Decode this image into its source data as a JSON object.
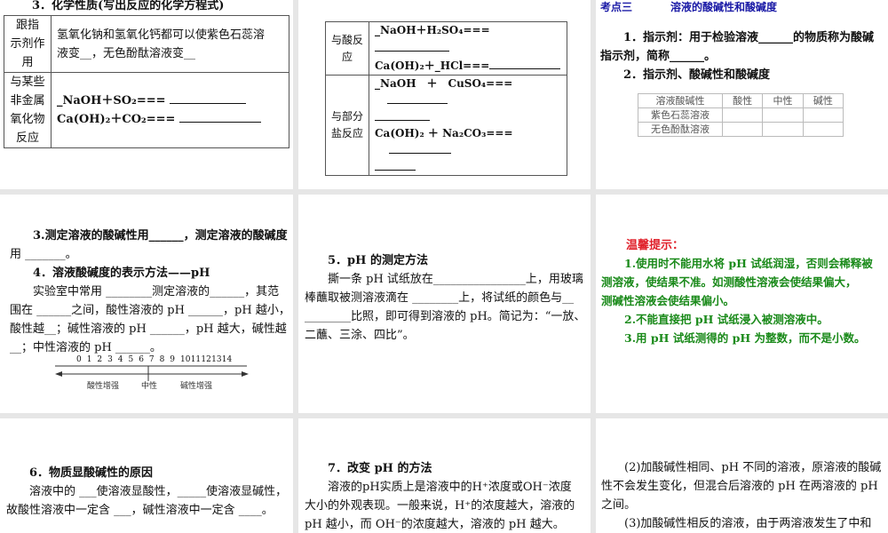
{
  "slides": {
    "s1": {
      "title": "3．化学性质(写出反应的化学方程式)",
      "rows": [
        {
          "head": [
            "跟指",
            "示剂作",
            "用"
          ],
          "lines": [
            "氢氧化钠和氢氧化钙都可以使紫色石蕊溶",
            "液变__，无色酚酞溶液变__"
          ]
        },
        {
          "head": [
            "与某些",
            "非金属",
            "氧化物",
            "反应"
          ],
          "lines": [
            "_NaOH＋SO₂===",
            "Ca(OH)₂＋CO₂==="
          ]
        }
      ]
    },
    "s2": {
      "rows": [
        {
          "head": [
            "与酸反",
            "应"
          ],
          "lines": [
            "_NaOH＋H₂SO₄===",
            "Ca(OH)₂＋_HCl==="
          ]
        },
        {
          "head": [
            "与部分",
            "盐反应"
          ],
          "lines": [
            "_NaOH　＋　CuSO₄===",
            "Ca(OH)₂ ＋ Na₂CO₃==="
          ]
        }
      ]
    },
    "s3": {
      "header_label": "考点三",
      "header_title": "溶液的酸碱性和酸碱度",
      "lines": [
        "1．指示剂：用于检验溶液______的物质称为酸碱",
        "指示剂，简称______。",
        "2．指示剂、酸碱性和酸碱度"
      ],
      "table": {
        "headers": [
          "溶液酸碱性",
          "酸性",
          "中性",
          "碱性"
        ],
        "rows": [
          "紫色石蕊溶液",
          "无色酚酞溶液"
        ]
      }
    },
    "s4": {
      "lines": [
        "3.测定溶液的酸碱性用______，测定溶液的酸碱度",
        "用 _______。",
        "4．溶液酸碱度的表示方法——pH",
        "实验室中常用 ________测定溶液的______，其范",
        "围在 ______之间，酸性溶液的 pH ______，pH 越小，",
        "酸性越__；碱性溶液的 pH ______，pH 越大，碱性越",
        "__；中性溶液的 pH ______。"
      ],
      "scale_ticks": [
        "0",
        "1",
        "2",
        "3",
        "4",
        "5",
        "6",
        "7",
        "8",
        "9",
        "10",
        "11",
        "12",
        "13",
        "14"
      ],
      "scale_labels": [
        "酸性增强",
        "中性",
        "碱性增强"
      ]
    },
    "s5": {
      "lines": [
        "5．pH 的测定方法",
        "撕一条 pH 试纸放在________________上，用玻璃",
        "棒蘸取被测溶液滴在 ________上，将试纸的颜色与__",
        "________比照，即可得到溶液的 pH。简记为：“一放、",
        "二蘸、三涂、四比”。"
      ]
    },
    "s6": {
      "title": "温馨提示：",
      "lines": [
        "1.使用时不能用水将 pH 试纸润湿，否则会稀释被",
        "测溶液，使结果不准。如测酸性溶液会使结果偏大，",
        "测碱性溶液会使结果偏小。",
        "2.不能直接把 pH 试纸浸入被测溶液中。",
        "3.用 pH 试纸测得的 pH 为整数，而不是小数。"
      ]
    },
    "s7": {
      "lines": [
        "6．物质显酸碱性的原因",
        "溶液中的 ___使溶液显酸性，_____使溶液显碱性，",
        "故酸性溶液中一定含 ___，碱性溶液中一定含 ____。"
      ]
    },
    "s8": {
      "lines": [
        "7．改变 pH 的方法",
        "溶液的pH实质上是溶液中的H⁺浓度或OH⁻浓度",
        "大小的外观表现。一般来说，H⁺的浓度越大，溶液的",
        "pH 越小，而 OH⁻的浓度越大，溶液的 pH 越大。"
      ]
    },
    "s9": {
      "lines": [
        "(2)加酸碱性相同、pH 不同的溶液，原溶液的酸碱",
        "性不会发生变化，但混合后溶液的 pH 在两溶液的 pH",
        "之间。",
        "(3)加酸碱性相反的溶液，由于两溶液发生了中和"
      ]
    }
  },
  "colors": {
    "header_blue": "#1a1aa6",
    "tip_red": "#e0202a",
    "tip_green": "#1a8a1a",
    "gutter": "#e6e6e6"
  }
}
